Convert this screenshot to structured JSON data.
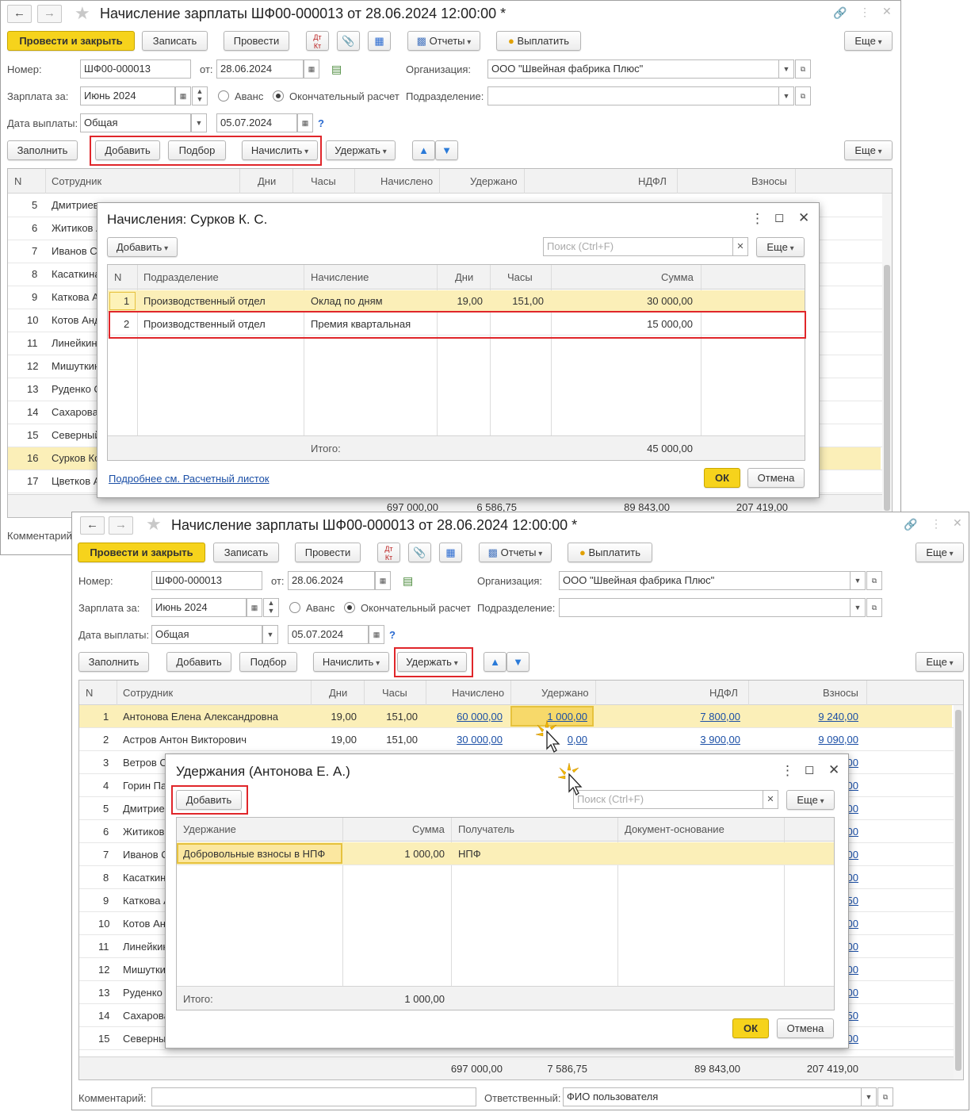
{
  "back_win": {
    "title": "Начисление зарплаты ШФ00-000013 от 28.06.2024 12:00:00 *",
    "toolbar": {
      "post_close": "Провести и закрыть",
      "save": "Записать",
      "post": "Провести",
      "reports": "Отчеты",
      "pay": "Выплатить",
      "more": "Еще"
    },
    "form": {
      "number_label": "Номер:",
      "number": "ШФ00-000013",
      "from_label": "от:",
      "date": "28.06.2024",
      "org_label": "Организация:",
      "org": "ООО \"Швейная фабрика Плюс\"",
      "period_label": "Зарплата за:",
      "period": "Июнь 2024",
      "advance": "Аванс",
      "final": "Окончательный расчет",
      "dept_label": "Подразделение:",
      "dept": "",
      "paydate_label": "Дата выплаты:",
      "paytype": "Общая",
      "paydate": "05.07.2024",
      "help": "?"
    },
    "tb2": {
      "fill": "Заполнить",
      "add": "Добавить",
      "pick": "Подбор",
      "accrue": "Начислить",
      "withhold": "Удержать",
      "more": "Еще"
    },
    "table": {
      "headers": [
        "N",
        "Сотрудник",
        "Дни",
        "Часы",
        "Начислено",
        "Удержано",
        "НДФЛ",
        "Взносы"
      ],
      "rows": [
        {
          "n": "5",
          "name": "Дмитриев"
        },
        {
          "n": "6",
          "name": "Житиков А"
        },
        {
          "n": "7",
          "name": "Иванов С"
        },
        {
          "n": "8",
          "name": "Касаткина"
        },
        {
          "n": "9",
          "name": "Каткова А"
        },
        {
          "n": "10",
          "name": "Котов Анд"
        },
        {
          "n": "11",
          "name": "Линейкин"
        },
        {
          "n": "12",
          "name": "Мишуткин"
        },
        {
          "n": "13",
          "name": "Руденко С"
        },
        {
          "n": "14",
          "name": "Сахарова"
        },
        {
          "n": "15",
          "name": "Северный"
        },
        {
          "n": "16",
          "name": "Сурков Ко"
        },
        {
          "n": "17",
          "name": "Цветков А"
        }
      ],
      "footer": {
        "accrued": "697 000,00",
        "withheld": "6 586,75",
        "ndfl": "89 843,00",
        "contrib": "207 419,00"
      }
    },
    "comment_label": "Комментарий:"
  },
  "dlg1": {
    "title": "Начисления: Сурков К. С.",
    "add": "Добавить",
    "search": "Поиск (Ctrl+F)",
    "more": "Еще",
    "headers": [
      "N",
      "Подразделение",
      "Начисление",
      "Дни",
      "Часы",
      "Сумма"
    ],
    "rows": [
      {
        "n": "1",
        "dept": "Производственный отдел",
        "type": "Оклад по дням",
        "days": "19,00",
        "hours": "151,00",
        "sum": "30 000,00"
      },
      {
        "n": "2",
        "dept": "Производственный отдел",
        "type": "Премия квартальная",
        "days": "",
        "hours": "",
        "sum": "15 000,00"
      }
    ],
    "total_label": "Итого:",
    "total": "45 000,00",
    "link": "Подробнее см. Расчетный листок",
    "ok": "ОК",
    "cancel": "Отмена"
  },
  "front_win": {
    "title": "Начисление зарплаты ШФ00-000013 от 28.06.2024 12:00:00 *",
    "toolbar": {
      "post_close": "Провести и закрыть",
      "save": "Записать",
      "post": "Провести",
      "reports": "Отчеты",
      "pay": "Выплатить",
      "more": "Еще"
    },
    "form": {
      "number_label": "Номер:",
      "number": "ШФ00-000013",
      "from_label": "от:",
      "date": "28.06.2024",
      "org_label": "Организация:",
      "org": "ООО \"Швейная фабрика Плюс\"",
      "period_label": "Зарплата за:",
      "period": "Июнь 2024",
      "advance": "Аванс",
      "final": "Окончательный расчет",
      "dept_label": "Подразделение:",
      "dept": "",
      "paydate_label": "Дата выплаты:",
      "paytype": "Общая",
      "paydate": "05.07.2024",
      "help": "?"
    },
    "tb2": {
      "fill": "Заполнить",
      "add": "Добавить",
      "pick": "Подбор",
      "accrue": "Начислить",
      "withhold": "Удержать",
      "more": "Еще"
    },
    "table": {
      "headers": [
        "N",
        "Сотрудник",
        "Дни",
        "Часы",
        "Начислено",
        "Удержано",
        "НДФЛ",
        "Взносы"
      ],
      "rows": [
        {
          "n": "1",
          "name": "Антонова Елена Александровна",
          "days": "19,00",
          "hours": "151,00",
          "acc": "60 000,00",
          "wh": "1 000,00",
          "ndfl": "7 800,00",
          "contrib": "9 240,00"
        },
        {
          "n": "2",
          "name": "Астров Антон Викторович",
          "days": "19,00",
          "hours": "151,00",
          "acc": "30 000,00",
          "wh": "0,00",
          "ndfl": "3 900,00",
          "contrib": "9 090,00"
        },
        {
          "n": "3",
          "name": "Ветров С",
          "contrib": "00"
        },
        {
          "n": "4",
          "name": "Горин Па",
          "contrib": "00"
        },
        {
          "n": "5",
          "name": "Дмитриев",
          "contrib": "00"
        },
        {
          "n": "6",
          "name": "Житиков",
          "contrib": "00"
        },
        {
          "n": "7",
          "name": "Иванов С",
          "contrib": "00"
        },
        {
          "n": "8",
          "name": "Касаткин",
          "contrib": "00"
        },
        {
          "n": "9",
          "name": "Каткова А",
          "contrib": "50"
        },
        {
          "n": "10",
          "name": "Котов Ан",
          "contrib": "00"
        },
        {
          "n": "11",
          "name": "Линейкин",
          "contrib": "00"
        },
        {
          "n": "12",
          "name": "Мишуткин",
          "contrib": "00"
        },
        {
          "n": "13",
          "name": "Руденко",
          "contrib": "00"
        },
        {
          "n": "14",
          "name": "Сахарова",
          "contrib": "50"
        },
        {
          "n": "15",
          "name": "Северны",
          "contrib": "00"
        }
      ],
      "footer": {
        "accrued": "697 000,00",
        "withheld": "7 586,75",
        "ndfl": "89 843,00",
        "contrib": "207 419,00"
      }
    },
    "comment_label": "Комментарий:",
    "resp_label": "Ответственный:",
    "resp": "ФИО пользователя"
  },
  "dlg2": {
    "title": "Удержания (Антонова Е. А.)",
    "add": "Добавить",
    "search": "Поиск (Ctrl+F)",
    "more": "Еще",
    "headers": [
      "Удержание",
      "Сумма",
      "Получатель",
      "Документ-основание"
    ],
    "rows": [
      {
        "type": "Добровольные взносы в НПФ",
        "sum": "1 000,00",
        "recipient": "НПФ",
        "basis": ""
      }
    ],
    "total_label": "Итого:",
    "total": "1 000,00",
    "ok": "ОК",
    "cancel": "Отмена"
  },
  "colors": {
    "accent_yellow": "#f6d31c",
    "selected_row": "#fbefb8",
    "highlight": "#e0262a",
    "link": "#1b4fa6"
  }
}
